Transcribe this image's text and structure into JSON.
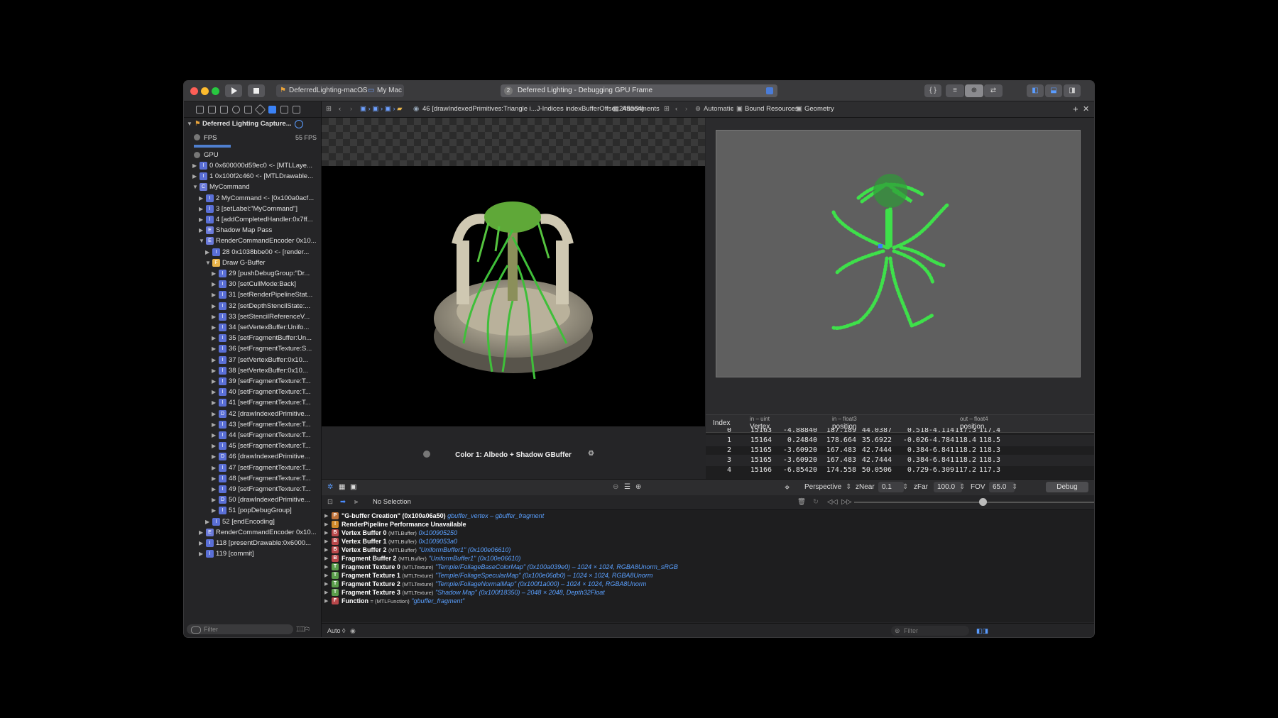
{
  "toolbar": {
    "scheme": "DeferredLighting-macOS",
    "destination": "My Mac",
    "activity_num": "2",
    "activity": "Deferred Lighting - Debugging GPU Frame"
  },
  "navigator": {
    "root": "Deferred Lighting Capture...",
    "fps_label": "FPS",
    "fps_value": "55 FPS",
    "gpu_label": "GPU",
    "filter_placeholder": "Filter",
    "items": [
      {
        "indent": 0,
        "tri": "▶",
        "badge": "I",
        "text": "0 0x600000d59ec0 <- [MTLLaye..."
      },
      {
        "indent": 0,
        "tri": "▶",
        "badge": "I",
        "text": "1 0x100f2c460 <- [MTLDrawable..."
      },
      {
        "indent": 0,
        "tri": "▼",
        "badge": "C",
        "text": "MyCommand"
      },
      {
        "indent": 1,
        "tri": "▶",
        "badge": "I",
        "text": "2 MyCommand <- [0x100a0acf..."
      },
      {
        "indent": 1,
        "tri": "▶",
        "badge": "I",
        "text": "3 [setLabel:\"MyCommand\"]"
      },
      {
        "indent": 1,
        "tri": "▶",
        "badge": "I",
        "text": "4 [addCompletedHandler:0x7ff..."
      },
      {
        "indent": 1,
        "tri": "▶",
        "badge": "E",
        "text": "Shadow Map Pass"
      },
      {
        "indent": 1,
        "tri": "▼",
        "badge": "E",
        "text": "RenderCommandEncoder 0x10..."
      },
      {
        "indent": 2,
        "tri": "▶",
        "badge": "I",
        "text": "28 0x1038bbe00 <- [render..."
      },
      {
        "indent": 2,
        "tri": "▼",
        "badge": "F",
        "text": "Draw G-Buffer"
      },
      {
        "indent": 3,
        "tri": "▶",
        "badge": "I",
        "text": "29 [pushDebugGroup:\"Dr..."
      },
      {
        "indent": 3,
        "tri": "▶",
        "badge": "I",
        "text": "30 [setCullMode:Back]"
      },
      {
        "indent": 3,
        "tri": "▶",
        "badge": "I",
        "text": "31 [setRenderPipelineStat..."
      },
      {
        "indent": 3,
        "tri": "▶",
        "badge": "I",
        "text": "32 [setDepthStencilState:..."
      },
      {
        "indent": 3,
        "tri": "▶",
        "badge": "I",
        "text": "33 [setStencilReferenceV..."
      },
      {
        "indent": 3,
        "tri": "▶",
        "badge": "I",
        "text": "34 [setVertexBuffer:Unifo..."
      },
      {
        "indent": 3,
        "tri": "▶",
        "badge": "I",
        "text": "35 [setFragmentBuffer:Un..."
      },
      {
        "indent": 3,
        "tri": "▶",
        "badge": "I",
        "text": "36 [setFragmentTexture:S..."
      },
      {
        "indent": 3,
        "tri": "▶",
        "badge": "I",
        "text": "37 [setVertexBuffer:0x10..."
      },
      {
        "indent": 3,
        "tri": "▶",
        "badge": "I",
        "text": "38 [setVertexBuffer:0x10..."
      },
      {
        "indent": 3,
        "tri": "▶",
        "badge": "I",
        "text": "39 [setFragmentTexture:T..."
      },
      {
        "indent": 3,
        "tri": "▶",
        "badge": "I",
        "text": "40 [setFragmentTexture:T..."
      },
      {
        "indent": 3,
        "tri": "▶",
        "badge": "I",
        "text": "41 [setFragmentTexture:T..."
      },
      {
        "indent": 3,
        "tri": "▶",
        "badge": "D",
        "text": "42 [drawIndexedPrimitive..."
      },
      {
        "indent": 3,
        "tri": "▶",
        "badge": "I",
        "text": "43 [setFragmentTexture:T..."
      },
      {
        "indent": 3,
        "tri": "▶",
        "badge": "I",
        "text": "44 [setFragmentTexture:T..."
      },
      {
        "indent": 3,
        "tri": "▶",
        "badge": "I",
        "text": "45 [setFragmentTexture:T..."
      },
      {
        "indent": 3,
        "tri": "▶",
        "badge": "D",
        "text": "46 [drawIndexedPrimitive..."
      },
      {
        "indent": 3,
        "tri": "▶",
        "badge": "I",
        "text": "47 [setFragmentTexture:T..."
      },
      {
        "indent": 3,
        "tri": "▶",
        "badge": "I",
        "text": "48 [setFragmentTexture:T..."
      },
      {
        "indent": 3,
        "tri": "▶",
        "badge": "I",
        "text": "49 [setFragmentTexture:T..."
      },
      {
        "indent": 3,
        "tri": "▶",
        "badge": "D",
        "text": "50 [drawIndexedPrimitive..."
      },
      {
        "indent": 3,
        "tri": "▶",
        "badge": "I",
        "text": "51 [popDebugGroup]"
      },
      {
        "indent": 2,
        "tri": "▶",
        "badge": "I",
        "text": "52 [endEncoding]"
      },
      {
        "indent": 1,
        "tri": "▶",
        "badge": "E",
        "text": "RenderCommandEncoder 0x10..."
      },
      {
        "indent": 1,
        "tri": "▶",
        "badge": "I",
        "text": "118 [presentDrawable:0x6000..."
      },
      {
        "indent": 1,
        "tri": "▶",
        "badge": "I",
        "text": "119 [commit]"
      }
    ]
  },
  "jumpbar": {
    "call": "46 [drawIndexedPrimitives:Triangle i...J-Indices indexBufferOffset:245064]",
    "attachments": "Attachments",
    "automatic": "Automatic",
    "bound": "Bound Resources",
    "geometry": "Geometry"
  },
  "viewer": {
    "caption": "Color 1: Albedo + Shadow GBuffer"
  },
  "table": {
    "col_index": "Index",
    "h_vertex_type": "in – uint",
    "h_vertex": "Vertex",
    "h_pos_type": "in – float3",
    "h_pos": "position",
    "h_out_type": "out – float4",
    "h_out": "position",
    "rows": [
      {
        "i": "0",
        "v": "15163",
        "p1": "-4.88840",
        "p2": "187.189",
        "p3": "44.0387",
        "o1": "0.518",
        "o2": "-4.114",
        "o3": "117.3",
        "o4": "117.4"
      },
      {
        "i": "1",
        "v": "15164",
        "p1": "0.24840",
        "p2": "178.664",
        "p3": "35.6922",
        "o1": "-0.026",
        "o2": "-4.784",
        "o3": "118.4",
        "o4": "118.5"
      },
      {
        "i": "2",
        "v": "15165",
        "p1": "-3.60920",
        "p2": "167.483",
        "p3": "42.7444",
        "o1": "0.384",
        "o2": "-6.841",
        "o3": "118.2",
        "o4": "118.3"
      },
      {
        "i": "3",
        "v": "15165",
        "p1": "-3.60920",
        "p2": "167.483",
        "p3": "42.7444",
        "o1": "0.384",
        "o2": "-6.841",
        "o3": "118.2",
        "o4": "118.3"
      },
      {
        "i": "4",
        "v": "15166",
        "p1": "-6.85420",
        "p2": "174.558",
        "p3": "50.0506",
        "o1": "0.729",
        "o2": "-6.309",
        "o3": "117.2",
        "o4": "117.3"
      }
    ]
  },
  "geobar": {
    "projection": "Perspective",
    "znear_label": "zNear",
    "znear": "0.1",
    "zfar_label": "zFar",
    "zfar": "100.0",
    "fov_label": "FOV",
    "fov": "65.0",
    "debug": "Debug"
  },
  "debugbar": {
    "selection": "No Selection"
  },
  "variables": [
    {
      "icon": "P",
      "color": "#c0733a",
      "name": "\"G-buffer Creation\" (0x100a06a50)",
      "type": "",
      "val": "gbuffer_vertex – gbuffer_fragment"
    },
    {
      "icon": "!",
      "color": "#d08a2a",
      "name": "RenderPipeline Performance Unavailable",
      "type": "",
      "val": ""
    },
    {
      "icon": "B",
      "color": "#b9474a",
      "name": "Vertex Buffer 0",
      "type": "(MTLBuffer)",
      "val": "0x100905250"
    },
    {
      "icon": "B",
      "color": "#b9474a",
      "name": "Vertex Buffer 1",
      "type": "(MTLBuffer)",
      "val": "0x1009053a0"
    },
    {
      "icon": "B",
      "color": "#b9474a",
      "name": "Vertex Buffer 2",
      "type": "(MTLBuffer)",
      "val": "\"UniformBuffer1\" (0x100e06610)"
    },
    {
      "icon": "B",
      "color": "#b9474a",
      "name": "Fragment Buffer 2",
      "type": "(MTLBuffer)",
      "val": "\"UniformBuffer1\" (0x100e06610)"
    },
    {
      "icon": "T",
      "color": "#5a9e4b",
      "name": "Fragment Texture 0",
      "type": "(MTLTexture)",
      "val": "\"Temple/FoliageBaseColorMap\" (0x100a039e0) – 1024 × 1024, RGBA8Unorm_sRGB"
    },
    {
      "icon": "T",
      "color": "#5a9e4b",
      "name": "Fragment Texture 1",
      "type": "(MTLTexture)",
      "val": "\"Temple/FoliageSpecularMap\" (0x100e06db0) – 1024 × 1024, RGBA8Unorm"
    },
    {
      "icon": "T",
      "color": "#5a9e4b",
      "name": "Fragment Texture 2",
      "type": "(MTLTexture)",
      "val": "\"Temple/FoliageNormalMap\" (0x100f1a000) – 1024 × 1024, RGBA8Unorm"
    },
    {
      "icon": "T",
      "color": "#5a9e4b",
      "name": "Fragment Texture 3",
      "type": "(MTLTexture)",
      "val": "\"Shadow Map\" (0x100f18350) – 2048 × 2048, Depth32Float"
    },
    {
      "icon": "F",
      "color": "#b9474a",
      "name": "Function",
      "type": "= (MTLFunction)",
      "val": "\"gbuffer_fragment\""
    }
  ],
  "bottom": {
    "auto": "Auto ◊",
    "filter_placeholder": "Filter"
  }
}
